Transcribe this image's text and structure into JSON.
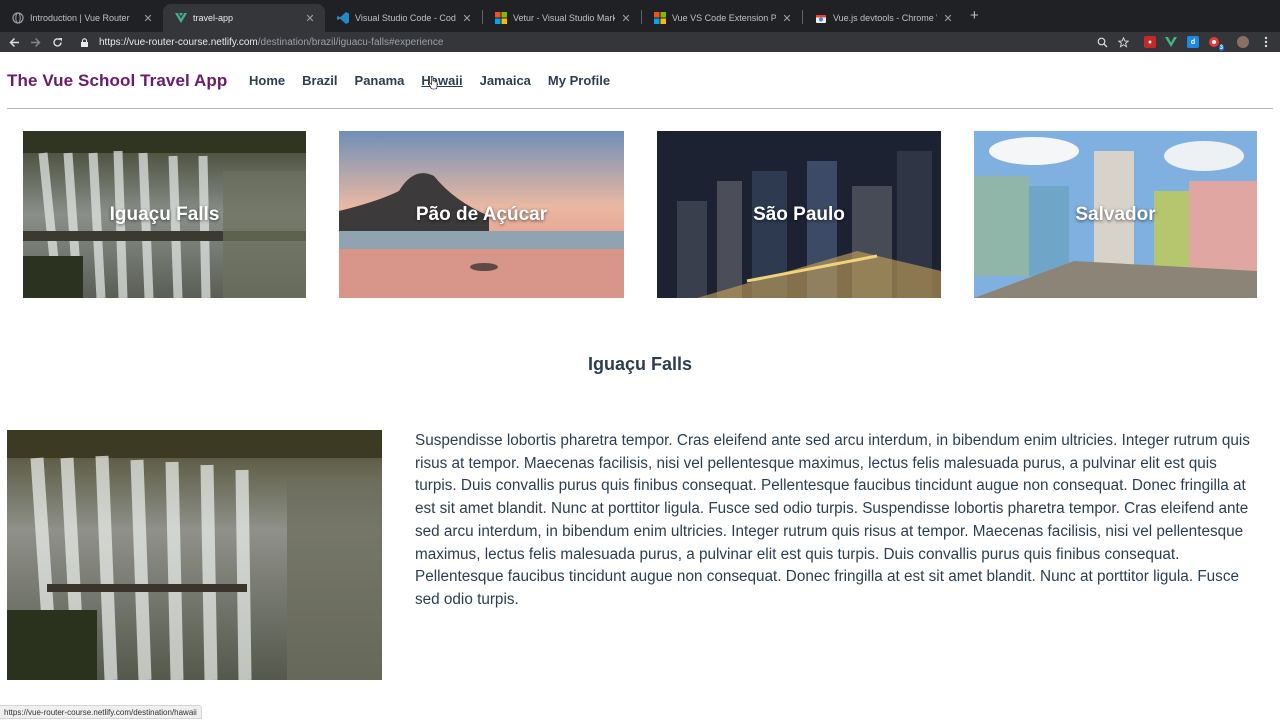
{
  "browser": {
    "tabs": [
      {
        "title": "Introduction | Vue Router",
        "icon": "globe-icon",
        "active": false
      },
      {
        "title": "travel-app",
        "icon": "vue-logo-icon",
        "active": true
      },
      {
        "title": "Visual Studio Code - Code Edit",
        "icon": "vscode-icon",
        "active": false
      },
      {
        "title": "Vetur - Visual Studio Marketpl",
        "icon": "microsoft-icon",
        "active": false
      },
      {
        "title": "Vue VS Code Extension Pack -",
        "icon": "microsoft-icon",
        "active": false
      },
      {
        "title": "Vue.js devtools - Chrome Web",
        "icon": "chrome-webstore-icon",
        "active": false
      }
    ],
    "url": {
      "scheme": "https://",
      "host": "vue-router-course.netlify.com",
      "path": "/destination/brazil/iguacu-falls#experience"
    },
    "extension_badge": "3",
    "status_url": "https://vue-router-course.netlify.com/destination/hawaii"
  },
  "app": {
    "brand": "The Vue School Travel App",
    "nav": [
      "Home",
      "Brazil",
      "Panama",
      "Hawaii",
      "Jamaica",
      "My Profile"
    ],
    "hovered_nav": "Hawaii",
    "experiences": [
      "Iguaçu Falls",
      "Pão de Açúcar",
      "São Paulo",
      "Salvador"
    ],
    "current": {
      "title": "Iguaçu Falls",
      "description": "Suspendisse lobortis pharetra tempor. Cras eleifend ante sed arcu interdum, in bibendum enim ultricies. Integer rutrum quis risus at tempor. Maecenas facilisis, nisi vel pellentesque maximus, lectus felis malesuada purus, a pulvinar elit est quis turpis. Duis convallis purus quis finibus consequat. Pellentesque faucibus tincidunt augue non consequat. Donec fringilla at est sit amet blandit. Nunc at porttitor ligula. Fusce sed odio turpis. Suspendisse lobortis pharetra tempor. Cras eleifend ante sed arcu interdum, in bibendum enim ultricies. Integer rutrum quis risus at tempor. Maecenas facilisis, nisi vel pellentesque maximus, lectus felis malesuada purus, a pulvinar elit est quis turpis. Duis convallis purus quis finibus consequat. Pellentesque faucibus tincidunt augue non consequat. Donec fringilla at est sit amet blandit. Nunc at porttitor ligula. Fusce sed odio turpis."
    }
  },
  "colors": {
    "brand": "#6a1b6b",
    "text": "#2c3e50",
    "tab_bar": "#202124",
    "toolbar": "#35363a"
  }
}
